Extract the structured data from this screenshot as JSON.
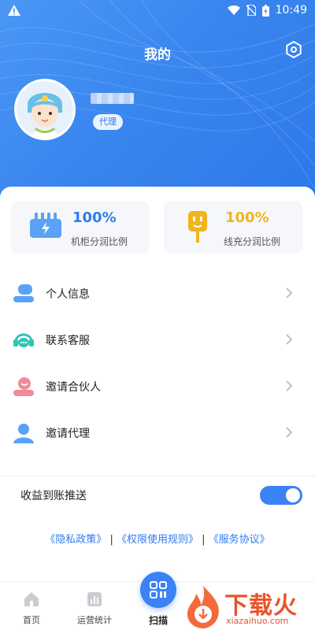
{
  "status_bar": {
    "time": "10:49"
  },
  "header": {
    "title": "我的"
  },
  "profile": {
    "role_badge": "代理"
  },
  "stats": [
    {
      "value": "100%",
      "label": "机柜分润比例",
      "color": "#2f7cf0"
    },
    {
      "value": "100%",
      "label": "线充分润比例",
      "color": "#f1b51c"
    }
  ],
  "menu": [
    {
      "label": "个人信息",
      "icon": "person-info-icon"
    },
    {
      "label": "联系客服",
      "icon": "headset-icon"
    },
    {
      "label": "邀请合伙人",
      "icon": "invite-partner-icon"
    },
    {
      "label": "邀请代理",
      "icon": "invite-agent-icon"
    }
  ],
  "settings_row": {
    "label": "收益到账推送",
    "enabled": true
  },
  "policies": {
    "privacy": "《隐私政策》",
    "sep1": "|",
    "permissions": "《权限使用规则》",
    "sep2": "|",
    "service": "《服务协议》"
  },
  "tabbar": {
    "home": "首页",
    "stats": "运营统计",
    "scan": "扫描"
  },
  "watermark": {
    "text": "下载火",
    "url": "xiazaihuo.com"
  },
  "colors": {
    "accent": "#3b82f6",
    "hero": "#3a86ef",
    "gold": "#f1b51c"
  }
}
